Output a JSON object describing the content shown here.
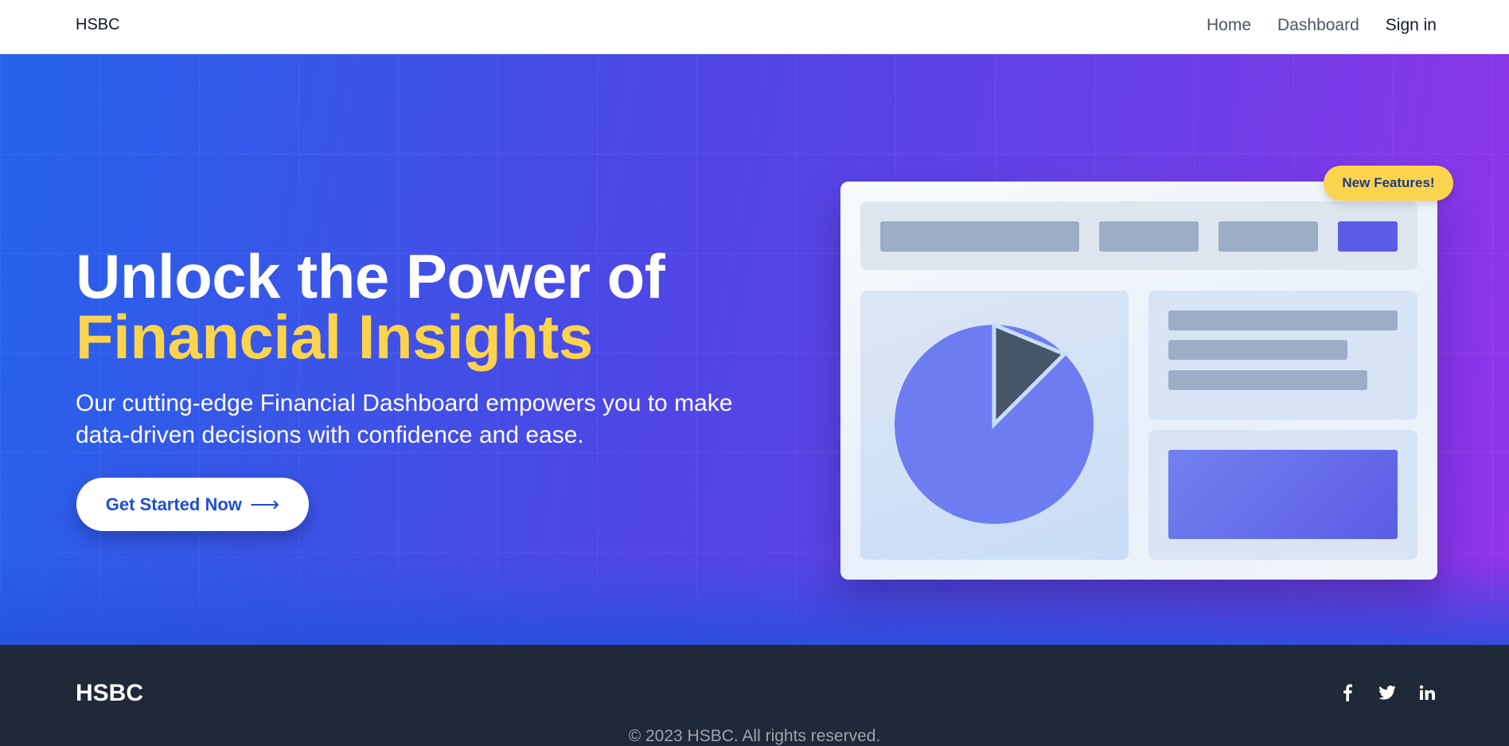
{
  "nav": {
    "brand": "HSBC",
    "links": [
      "Home",
      "Dashboard",
      "Sign in"
    ]
  },
  "hero": {
    "title_line1": "Unlock the Power of",
    "title_line2": "Financial Insights",
    "subtitle": "Our cutting-edge Financial Dashboard empowers you to make data-driven decisions with confidence and ease.",
    "cta_label": "Get Started Now",
    "cta_icon": "arrow-right-icon",
    "badge": "New Features!"
  },
  "illustration": {
    "pie_highlight_fraction": 0.125
  },
  "footer": {
    "brand": "HSBC",
    "social": [
      "facebook-icon",
      "twitter-icon",
      "linkedin-icon"
    ],
    "copyright": "© 2023 HSBC. All rights reserved."
  },
  "colors": {
    "accent_yellow": "#fcd34d",
    "hero_start": "#2563eb",
    "hero_end": "#9333ea",
    "footer_bg": "#1f2937",
    "cta_text": "#1d4ed8"
  }
}
